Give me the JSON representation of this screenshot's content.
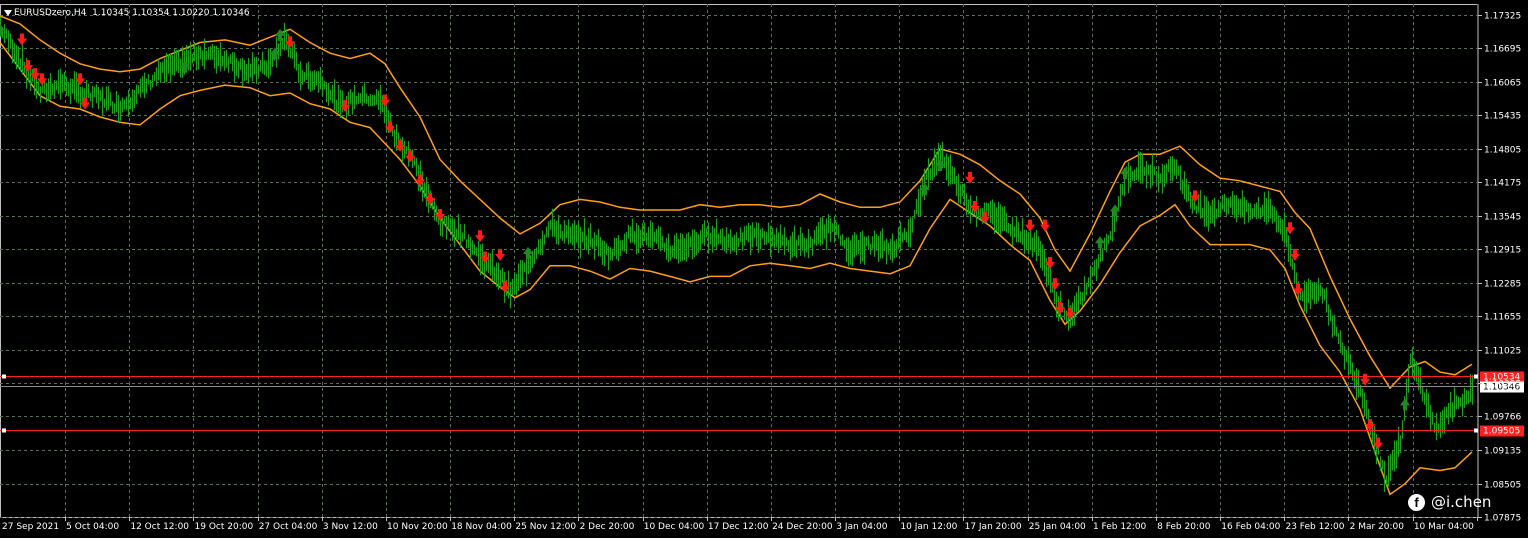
{
  "header": {
    "symbol_timeframe": "EURUSDzero,H4",
    "ohlc": "1.10345 1.10354 1.10220 1.10346"
  },
  "watermark": {
    "icon": "facebook-icon",
    "handle": "@i.chen"
  },
  "colors": {
    "background": "#000000",
    "grid": "#5a6e5a",
    "price_bars": "#1fa01f",
    "bands": "#ff9f1a",
    "sell_arrows": "#ff1a1a",
    "buy_arrows": "#1f8a1f",
    "horizontal_lines": "#ff2020",
    "current_price_bg": "#ffffff"
  },
  "chart_data": {
    "type": "line",
    "title": "EURUSDzero,H4",
    "ylim": [
      1.07875,
      1.17525
    ],
    "y_ticks": [
      "1.17325",
      "1.16695",
      "1.16065",
      "1.15435",
      "1.14805",
      "1.14175",
      "1.13545",
      "1.12915",
      "1.12285",
      "1.11655",
      "1.11025",
      "1.10395",
      "1.09766",
      "1.09135",
      "1.08505",
      "1.07875"
    ],
    "x_ticks": [
      "27 Sep 2021",
      "5 Oct 04:00",
      "12 Oct 12:00",
      "19 Oct 20:00",
      "27 Oct 04:00",
      "3 Nov 12:00",
      "10 Nov 20:00",
      "18 Nov 04:00",
      "25 Nov 12:00",
      "2 Dec 20:00",
      "10 Dec 04:00",
      "17 Dec 12:00",
      "24 Dec 20:00",
      "3 Jan 04:00",
      "10 Jan 12:00",
      "17 Jan 20:00",
      "25 Jan 04:00",
      "1 Feb 12:00",
      "8 Feb 20:00",
      "16 Feb 04:00",
      "23 Feb 12:00",
      "2 Mar 20:00",
      "10 Mar 04:00"
    ],
    "price_labels": {
      "upper_line": "1.10534",
      "current": "1.10346",
      "lower_line": "1.09505"
    },
    "horizontal_lines": [
      1.10534,
      1.09505
    ],
    "current_price": 1.10346,
    "price_path": [
      [
        0,
        1.1709
      ],
      [
        22,
        1.164
      ],
      [
        40,
        1.1585
      ],
      [
        60,
        1.1605
      ],
      [
        80,
        1.1585
      ],
      [
        100,
        1.1575
      ],
      [
        120,
        1.156
      ],
      [
        140,
        1.159
      ],
      [
        160,
        1.1625
      ],
      [
        180,
        1.164
      ],
      [
        200,
        1.166
      ],
      [
        225,
        1.165
      ],
      [
        250,
        1.1625
      ],
      [
        270,
        1.164
      ],
      [
        285,
        1.169
      ],
      [
        300,
        1.162
      ],
      [
        320,
        1.161
      ],
      [
        340,
        1.156
      ],
      [
        360,
        1.158
      ],
      [
        380,
        1.157
      ],
      [
        395,
        1.15
      ],
      [
        410,
        1.147
      ],
      [
        425,
        1.14
      ],
      [
        440,
        1.134
      ],
      [
        460,
        1.1325
      ],
      [
        480,
        1.1275
      ],
      [
        500,
        1.124
      ],
      [
        510,
        1.121
      ],
      [
        530,
        1.127
      ],
      [
        550,
        1.1335
      ],
      [
        570,
        1.1315
      ],
      [
        590,
        1.131
      ],
      [
        610,
        1.128
      ],
      [
        630,
        1.132
      ],
      [
        650,
        1.1315
      ],
      [
        670,
        1.129
      ],
      [
        690,
        1.13
      ],
      [
        710,
        1.132
      ],
      [
        730,
        1.1305
      ],
      [
        750,
        1.1315
      ],
      [
        770,
        1.1315
      ],
      [
        790,
        1.13
      ],
      [
        810,
        1.13
      ],
      [
        830,
        1.1335
      ],
      [
        850,
        1.129
      ],
      [
        870,
        1.13
      ],
      [
        890,
        1.129
      ],
      [
        910,
        1.133
      ],
      [
        925,
        1.142
      ],
      [
        940,
        1.147
      ],
      [
        955,
        1.142
      ],
      [
        970,
        1.137
      ],
      [
        985,
        1.136
      ],
      [
        1000,
        1.135
      ],
      [
        1020,
        1.132
      ],
      [
        1040,
        1.129
      ],
      [
        1055,
        1.1195
      ],
      [
        1070,
        1.116
      ],
      [
        1085,
        1.1215
      ],
      [
        1100,
        1.1275
      ],
      [
        1115,
        1.135
      ],
      [
        1125,
        1.143
      ],
      [
        1140,
        1.144
      ],
      [
        1160,
        1.143
      ],
      [
        1175,
        1.145
      ],
      [
        1190,
        1.138
      ],
      [
        1210,
        1.136
      ],
      [
        1230,
        1.138
      ],
      [
        1250,
        1.136
      ],
      [
        1270,
        1.137
      ],
      [
        1285,
        1.132
      ],
      [
        1300,
        1.12
      ],
      [
        1320,
        1.122
      ],
      [
        1340,
        1.111
      ],
      [
        1360,
        1.103
      ],
      [
        1375,
        1.093
      ],
      [
        1385,
        1.086
      ],
      [
        1400,
        1.093
      ],
      [
        1410,
        1.108
      ],
      [
        1420,
        1.104
      ],
      [
        1435,
        1.095
      ],
      [
        1450,
        1.099
      ],
      [
        1465,
        1.101
      ],
      [
        1472,
        1.1035
      ]
    ],
    "upper_band": [
      [
        0,
        1.173
      ],
      [
        20,
        1.1715
      ],
      [
        40,
        1.1685
      ],
      [
        60,
        1.166
      ],
      [
        80,
        1.164
      ],
      [
        100,
        1.163
      ],
      [
        120,
        1.1625
      ],
      [
        140,
        1.163
      ],
      [
        160,
        1.165
      ],
      [
        180,
        1.1665
      ],
      [
        200,
        1.168
      ],
      [
        225,
        1.1685
      ],
      [
        250,
        1.1675
      ],
      [
        270,
        1.169
      ],
      [
        290,
        1.1705
      ],
      [
        310,
        1.168
      ],
      [
        330,
        1.166
      ],
      [
        350,
        1.165
      ],
      [
        370,
        1.166
      ],
      [
        385,
        1.164
      ],
      [
        400,
        1.1595
      ],
      [
        420,
        1.154
      ],
      [
        440,
        1.146
      ],
      [
        460,
        1.142
      ],
      [
        480,
        1.1385
      ],
      [
        500,
        1.135
      ],
      [
        520,
        1.132
      ],
      [
        540,
        1.134
      ],
      [
        560,
        1.1375
      ],
      [
        580,
        1.1385
      ],
      [
        600,
        1.138
      ],
      [
        620,
        1.137
      ],
      [
        640,
        1.1365
      ],
      [
        660,
        1.1365
      ],
      [
        680,
        1.1365
      ],
      [
        700,
        1.1375
      ],
      [
        720,
        1.137
      ],
      [
        740,
        1.1375
      ],
      [
        760,
        1.1375
      ],
      [
        780,
        1.137
      ],
      [
        800,
        1.1375
      ],
      [
        820,
        1.1395
      ],
      [
        840,
        1.138
      ],
      [
        860,
        1.137
      ],
      [
        880,
        1.137
      ],
      [
        900,
        1.138
      ],
      [
        920,
        1.142
      ],
      [
        940,
        1.148
      ],
      [
        960,
        1.147
      ],
      [
        980,
        1.145
      ],
      [
        1000,
        1.142
      ],
      [
        1020,
        1.1395
      ],
      [
        1040,
        1.135
      ],
      [
        1055,
        1.129
      ],
      [
        1070,
        1.125
      ],
      [
        1090,
        1.132
      ],
      [
        1110,
        1.14
      ],
      [
        1125,
        1.1455
      ],
      [
        1140,
        1.147
      ],
      [
        1160,
        1.147
      ],
      [
        1180,
        1.1485
      ],
      [
        1200,
        1.145
      ],
      [
        1220,
        1.1425
      ],
      [
        1240,
        1.142
      ],
      [
        1260,
        1.141
      ],
      [
        1280,
        1.14
      ],
      [
        1295,
        1.136
      ],
      [
        1310,
        1.133
      ],
      [
        1330,
        1.124
      ],
      [
        1350,
        1.116
      ],
      [
        1370,
        1.109
      ],
      [
        1390,
        1.103
      ],
      [
        1410,
        1.107
      ],
      [
        1425,
        1.108
      ],
      [
        1440,
        1.106
      ],
      [
        1455,
        1.1055
      ],
      [
        1472,
        1.1075
      ]
    ],
    "lower_band": [
      [
        0,
        1.168
      ],
      [
        20,
        1.163
      ],
      [
        40,
        1.158
      ],
      [
        60,
        1.156
      ],
      [
        80,
        1.1555
      ],
      [
        100,
        1.154
      ],
      [
        120,
        1.153
      ],
      [
        140,
        1.1525
      ],
      [
        160,
        1.1555
      ],
      [
        180,
        1.158
      ],
      [
        200,
        1.159
      ],
      [
        225,
        1.16
      ],
      [
        250,
        1.1595
      ],
      [
        270,
        1.158
      ],
      [
        290,
        1.1585
      ],
      [
        310,
        1.1565
      ],
      [
        330,
        1.1555
      ],
      [
        350,
        1.153
      ],
      [
        370,
        1.152
      ],
      [
        385,
        1.149
      ],
      [
        400,
        1.146
      ],
      [
        420,
        1.141
      ],
      [
        440,
        1.135
      ],
      [
        460,
        1.13
      ],
      [
        480,
        1.125
      ],
      [
        500,
        1.122
      ],
      [
        515,
        1.12
      ],
      [
        530,
        1.1215
      ],
      [
        550,
        1.126
      ],
      [
        570,
        1.126
      ],
      [
        590,
        1.125
      ],
      [
        610,
        1.1235
      ],
      [
        630,
        1.1255
      ],
      [
        650,
        1.125
      ],
      [
        670,
        1.124
      ],
      [
        690,
        1.123
      ],
      [
        710,
        1.124
      ],
      [
        730,
        1.124
      ],
      [
        750,
        1.126
      ],
      [
        770,
        1.1265
      ],
      [
        790,
        1.126
      ],
      [
        810,
        1.1255
      ],
      [
        830,
        1.1265
      ],
      [
        850,
        1.1255
      ],
      [
        870,
        1.125
      ],
      [
        890,
        1.1245
      ],
      [
        910,
        1.126
      ],
      [
        930,
        1.133
      ],
      [
        950,
        1.1385
      ],
      [
        970,
        1.136
      ],
      [
        990,
        1.1335
      ],
      [
        1010,
        1.13
      ],
      [
        1030,
        1.127
      ],
      [
        1050,
        1.1195
      ],
      [
        1065,
        1.115
      ],
      [
        1080,
        1.1175
      ],
      [
        1100,
        1.1225
      ],
      [
        1120,
        1.1285
      ],
      [
        1140,
        1.1335
      ],
      [
        1160,
        1.1355
      ],
      [
        1175,
        1.1375
      ],
      [
        1190,
        1.1335
      ],
      [
        1210,
        1.13
      ],
      [
        1230,
        1.13
      ],
      [
        1250,
        1.13
      ],
      [
        1270,
        1.129
      ],
      [
        1285,
        1.1255
      ],
      [
        1300,
        1.1185
      ],
      [
        1320,
        1.111
      ],
      [
        1340,
        1.106
      ],
      [
        1360,
        1.099
      ],
      [
        1375,
        1.091
      ],
      [
        1390,
        1.083
      ],
      [
        1405,
        1.085
      ],
      [
        1420,
        1.088
      ],
      [
        1440,
        1.0875
      ],
      [
        1455,
        1.088
      ],
      [
        1472,
        1.091
      ]
    ],
    "sell_signals": [
      [
        22,
        1.168
      ],
      [
        28,
        1.163
      ],
      [
        35,
        1.1615
      ],
      [
        42,
        1.1605
      ],
      [
        80,
        1.1605
      ],
      [
        85,
        1.156
      ],
      [
        290,
        1.1675
      ],
      [
        345,
        1.1555
      ],
      [
        385,
        1.1565
      ],
      [
        390,
        1.1515
      ],
      [
        400,
        1.148
      ],
      [
        410,
        1.146
      ],
      [
        420,
        1.1415
      ],
      [
        430,
        1.138
      ],
      [
        440,
        1.135
      ],
      [
        480,
        1.131
      ],
      [
        485,
        1.127
      ],
      [
        500,
        1.1275
      ],
      [
        505,
        1.1215
      ],
      [
        970,
        1.142
      ],
      [
        975,
        1.1365
      ],
      [
        985,
        1.1345
      ],
      [
        1030,
        1.133
      ],
      [
        1045,
        1.133
      ],
      [
        1050,
        1.126
      ],
      [
        1055,
        1.122
      ],
      [
        1060,
        1.1175
      ],
      [
        1070,
        1.1165
      ],
      [
        1195,
        1.1385
      ],
      [
        1290,
        1.1325
      ],
      [
        1295,
        1.1275
      ],
      [
        1298,
        1.121
      ],
      [
        1365,
        1.104
      ],
      [
        1370,
        1.0955
      ],
      [
        1378,
        1.092
      ]
    ],
    "buy_signals": [
      [
        0,
        1.171
      ],
      [
        185,
        1.164
      ],
      [
        275,
        1.1665
      ],
      [
        280,
        1.17
      ],
      [
        528,
        1.129
      ],
      [
        925,
        1.141
      ],
      [
        940,
        1.1455
      ],
      [
        1100,
        1.131
      ],
      [
        1115,
        1.137
      ],
      [
        1125,
        1.144
      ],
      [
        1405,
        1.1005
      ]
    ]
  }
}
